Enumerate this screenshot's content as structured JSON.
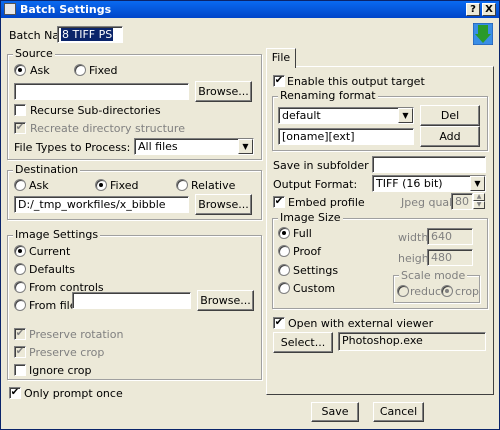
{
  "title": "Batch Settings",
  "title_buttons": {
    "help": "?",
    "close": "X"
  },
  "batch_name": {
    "label": "Batch Name",
    "value": "8 TIFF PS"
  },
  "source": {
    "title": "Source",
    "ask": "Ask",
    "fixed": "Fixed",
    "path_value": "",
    "browse": "Browse...",
    "recurse": "Recurse Sub-directories",
    "recreate": "Recreate directory structure",
    "file_types_label": "File Types to Process:",
    "file_types_value": "All files"
  },
  "destination": {
    "title": "Destination",
    "ask": "Ask",
    "fixed": "Fixed",
    "relative": "Relative",
    "path_value": "D:/_tmp_workfiles/x_bibble",
    "browse": "Browse..."
  },
  "image_settings": {
    "title": "Image Settings",
    "current": "Current",
    "defaults": "Defaults",
    "from_controls": "From controls",
    "from_file": "From file",
    "file_value": "",
    "browse": "Browse...",
    "preserve_rotation": "Preserve rotation",
    "preserve_crop": "Preserve crop",
    "ignore_crop": "Ignore crop"
  },
  "only_prompt_once": "Only prompt once",
  "tab_file": "File",
  "file_tab": {
    "enable_output": "Enable this output target",
    "renaming_title": "Renaming format",
    "renaming_select": "default",
    "del": "Del",
    "format_value": "[oname][ext]",
    "add": "Add",
    "save_subfolder_label": "Save in subfolder",
    "save_subfolder_value": "",
    "output_format_label": "Output Format:",
    "output_format_value": "TIFF (16 bit)",
    "embed_profile": "Embed profile",
    "jpeg_quality_label": "Jpeg quality",
    "jpeg_quality_value": "80",
    "image_size_title": "Image Size",
    "full": "Full",
    "proof": "Proof",
    "settings": "Settings",
    "custom": "Custom",
    "width_label": "width",
    "width_value": "640",
    "height_label": "height",
    "height_value": "480",
    "scale_mode_title": "Scale mode",
    "reduce": "reduce",
    "crop": "crop",
    "open_viewer": "Open with external viewer",
    "select": "Select...",
    "viewer_value": "Photoshop.exe"
  },
  "save": "Save",
  "cancel": "Cancel",
  "colors": {
    "title_bar": "#0054e3",
    "selection": "#0a246a"
  }
}
